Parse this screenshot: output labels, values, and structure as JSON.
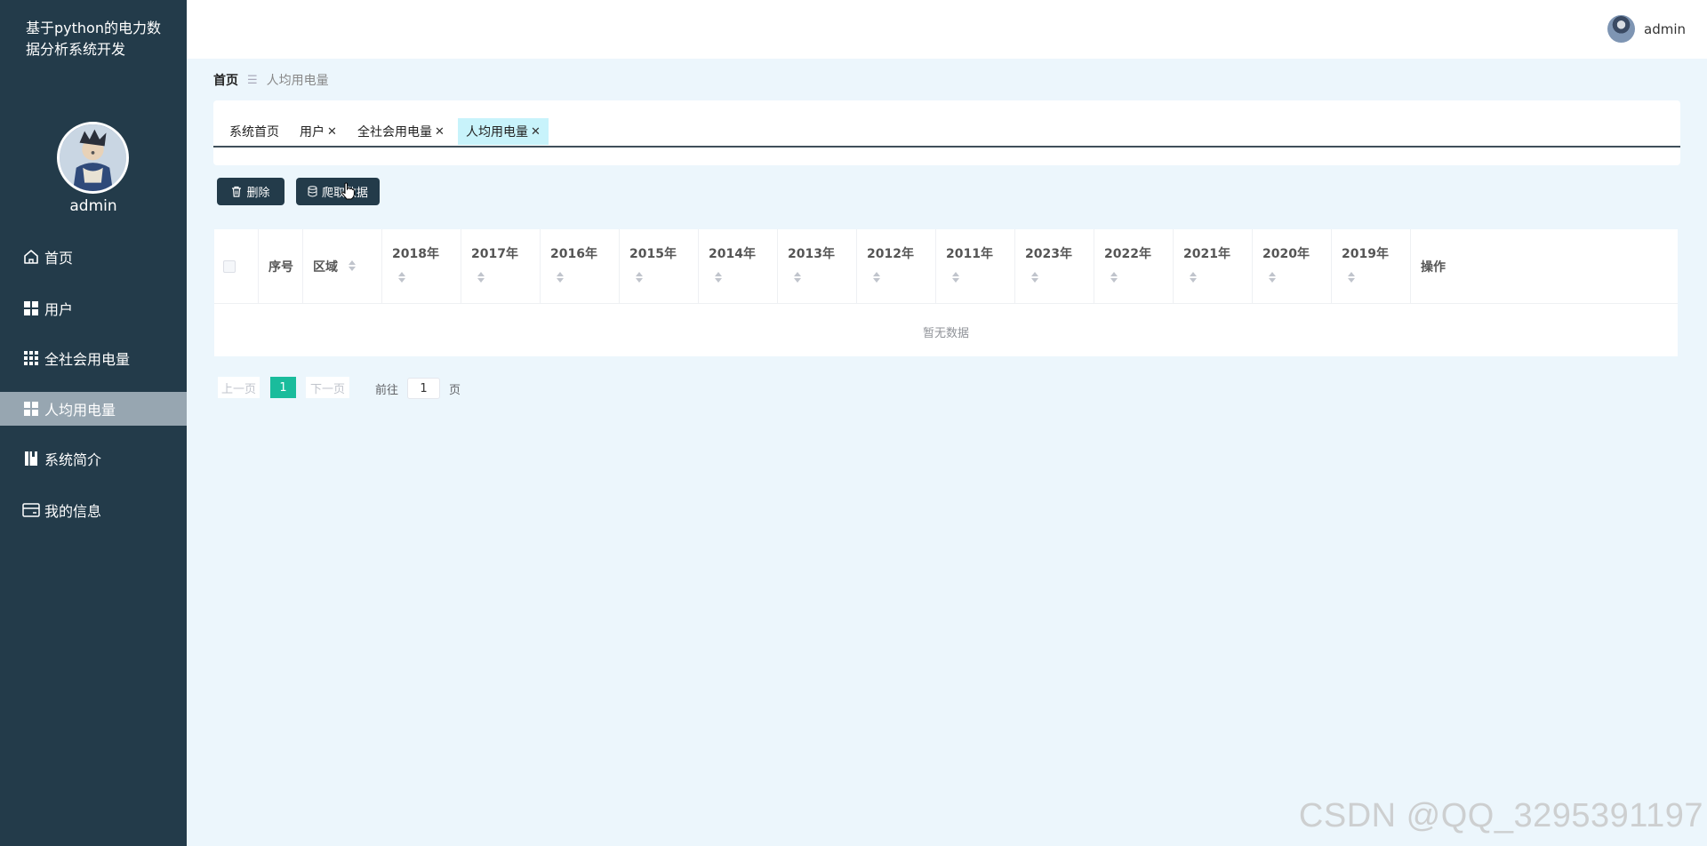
{
  "app": {
    "title": "基于python的电力数据分析系统开发"
  },
  "user": {
    "name": "admin"
  },
  "sidebar": {
    "items": [
      {
        "label": "首页",
        "icon": "home-icon",
        "active": false
      },
      {
        "label": "用户",
        "icon": "grid-icon",
        "active": false
      },
      {
        "label": "全社会用电量",
        "icon": "apps-icon",
        "active": false
      },
      {
        "label": "人均用电量",
        "icon": "grid-icon",
        "active": true
      },
      {
        "label": "系统简介",
        "icon": "book-icon",
        "active": false
      },
      {
        "label": "我的信息",
        "icon": "card-icon",
        "active": false
      }
    ]
  },
  "breadcrumb": {
    "home": "首页",
    "separator": "☰",
    "current": "人均用电量"
  },
  "tags": [
    {
      "label": "系统首页",
      "closable": false
    },
    {
      "label": "用户",
      "closable": true
    },
    {
      "label": "全社会用电量",
      "closable": true
    },
    {
      "label": "人均用电量",
      "closable": true,
      "active": true
    }
  ],
  "toolbar": {
    "delete_label": "删除",
    "crawl_label": "爬取数据"
  },
  "table": {
    "columns": [
      "序号",
      "区域",
      "2018年",
      "2017年",
      "2016年",
      "2015年",
      "2014年",
      "2013年",
      "2012年",
      "2011年",
      "2023年",
      "2022年",
      "2021年",
      "2020年",
      "2019年",
      "操作"
    ],
    "empty_text": "暂无数据"
  },
  "pagination": {
    "prev": "上一页",
    "current": "1",
    "next": "下一页",
    "goto_prefix": "前往",
    "goto_value": "1",
    "goto_suffix": "页"
  },
  "watermark": "CSDN @QQ_3295391197",
  "colors": {
    "sidebar_bg": "#233b4a",
    "active_menu_bg": "#97a6b1",
    "page_bg": "#ecf6fc",
    "active_tag_bg": "#c8f3fb",
    "pager_active": "#1abc9c"
  }
}
